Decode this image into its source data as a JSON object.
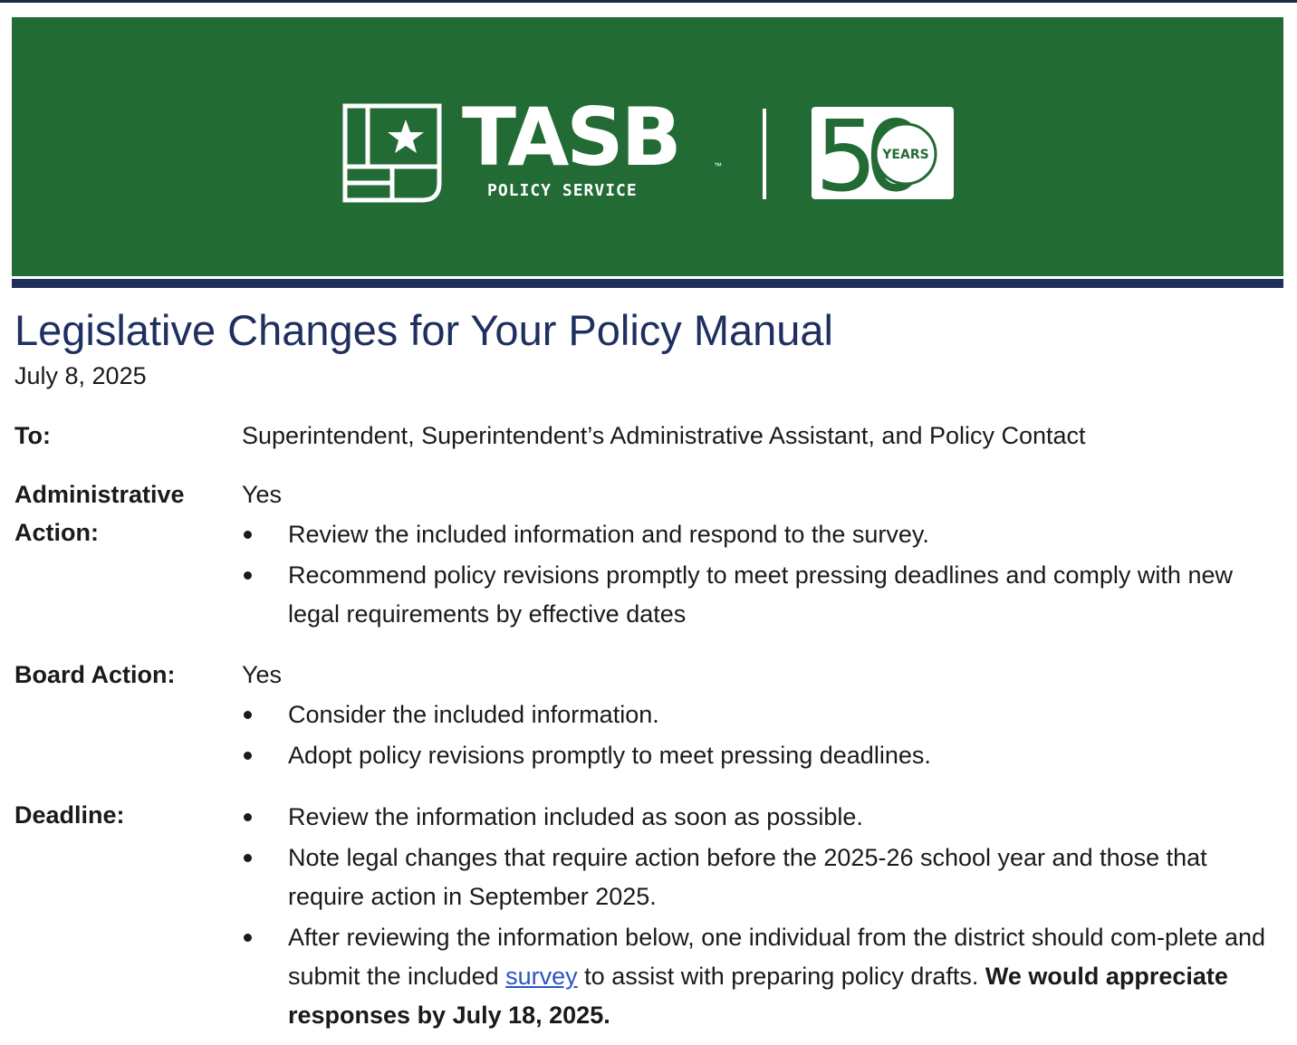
{
  "colors": {
    "banner_green": "#226b35",
    "banner_rule_navy": "#1e2f5b",
    "title_navy": "#1f3060",
    "link_blue": "#2a55c4"
  },
  "banner": {
    "logo_icon": "flag-grid-star-icon",
    "brand_name": "TASB",
    "brand_sub": "POLICY SERVICE",
    "trademark": "™",
    "anniversary_number": "50",
    "anniversary_label": "YEARS"
  },
  "document": {
    "title": "Legislative Changes for Your Policy Manual",
    "date": "July 8, 2025"
  },
  "memo": {
    "to_label": "To:",
    "to_value": "Superintendent, Superintendent’s Administrative Assistant, and Policy Contact",
    "admin_label_line1": "Administrative",
    "admin_label_line2": "Action:",
    "admin_value": "Yes",
    "admin_bullets": [
      "Review the included information and respond to the survey.",
      "Recommend policy revisions promptly to meet pressing deadlines and comply with new legal requirements by effective dates"
    ],
    "board_label": "Board Action:",
    "board_value": "Yes",
    "board_bullets": [
      "Consider the included information.",
      "Adopt policy revisions promptly to meet pressing deadlines."
    ],
    "deadline_label": "Deadline:",
    "deadline_bullets": [
      "Review the information included as soon as possible.",
      "Note legal changes that require action before the 2025-26 school year and those that require action in September 2025."
    ],
    "deadline_bullet3_before": "After reviewing the information below, one individual from the district should com-plete and submit the included ",
    "survey_link": "survey",
    "deadline_bullet3_after": " to assist with preparing policy drafts. ",
    "deadline_bullet3_bold": "We would appreciate responses by July 18, 2025."
  }
}
